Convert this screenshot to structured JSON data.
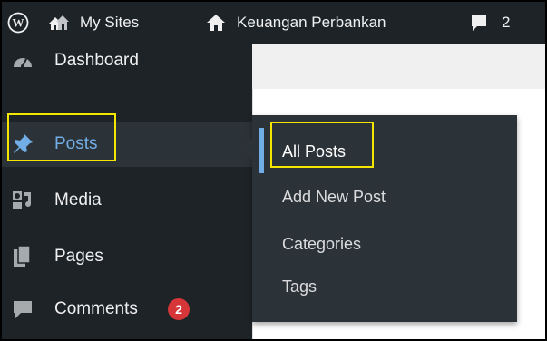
{
  "adminbar": {
    "my_sites": "My Sites",
    "site_name": "Keuangan Perbankan",
    "comments_count": "2"
  },
  "sidebar": {
    "items": [
      {
        "label": "Dashboard",
        "icon": "dashboard-icon"
      },
      {
        "label": "Posts",
        "icon": "pushpin-icon"
      },
      {
        "label": "Media",
        "icon": "media-icon"
      },
      {
        "label": "Pages",
        "icon": "pages-icon"
      },
      {
        "label": "Comments",
        "icon": "comments-icon",
        "badge": "2"
      }
    ]
  },
  "submenu": {
    "items": [
      {
        "label": "All Posts"
      },
      {
        "label": "Add New Post"
      },
      {
        "label": "Categories"
      },
      {
        "label": "Tags"
      }
    ]
  },
  "colors": {
    "bar_bg": "#1d2327",
    "active_bg": "#2c3338",
    "accent": "#72aee6",
    "badge": "#d63638",
    "highlight": "#f5e600"
  }
}
